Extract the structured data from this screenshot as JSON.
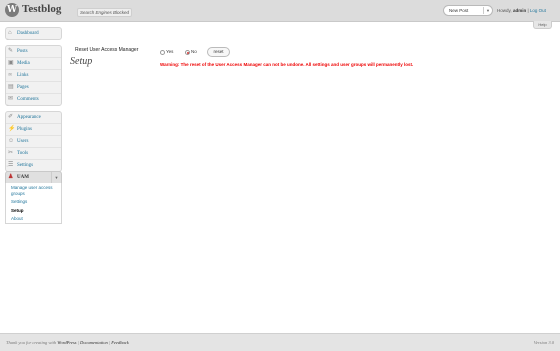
{
  "header": {
    "site_title": "Testblog",
    "visit_site": "Search Engines Blocked",
    "new_post": "New Post",
    "howdy_prefix": "Howdy,",
    "user": "admin",
    "separator": "|",
    "logout": "Log Out",
    "help": "Help"
  },
  "menu": {
    "dashboard": "Dashboard",
    "posts": "Posts",
    "media": "Media",
    "links": "Links",
    "pages": "Pages",
    "comments": "Comments",
    "appearance": "Appearance",
    "plugins": "Plugins",
    "users": "Users",
    "tools": "Tools",
    "settings": "Settings",
    "uam": "UAM",
    "uam_sub": {
      "manage_line1": "Manage user access",
      "manage_line2": "groups",
      "settings": "Settings",
      "setup": "Setup",
      "about": "About"
    }
  },
  "main": {
    "title": "Setup",
    "reset_label": "Reset User Access Manager",
    "yes": "Yes",
    "no": "No",
    "reset_button": "reset",
    "selected": "no",
    "warning": "Warning: The reset of the User Access Manager can not be undone. All settings and user groups will permanently lost."
  },
  "footer": {
    "thanks": "Thank you for creating with",
    "wordpress": "WordPress",
    "sep1": "|",
    "documentation": "Documentation",
    "sep2": "|",
    "feedback": "Feedback",
    "version": "Version 3.0"
  },
  "icons": {
    "wp_logo": "wordpress-logo-icon",
    "dashboard": "dashboard-icon",
    "posts": "pin-icon",
    "media": "media-icon",
    "links": "link-icon",
    "pages": "pages-icon",
    "comments": "comment-icon",
    "appearance": "brush-icon",
    "plugins": "plug-icon",
    "users": "users-icon",
    "tools": "tools-icon",
    "settings": "settings-icon",
    "uam": "uam-user-icon"
  },
  "colors": {
    "link": "#21759b",
    "warning": "#ee0000",
    "header_bg": "#dcdcdc"
  }
}
